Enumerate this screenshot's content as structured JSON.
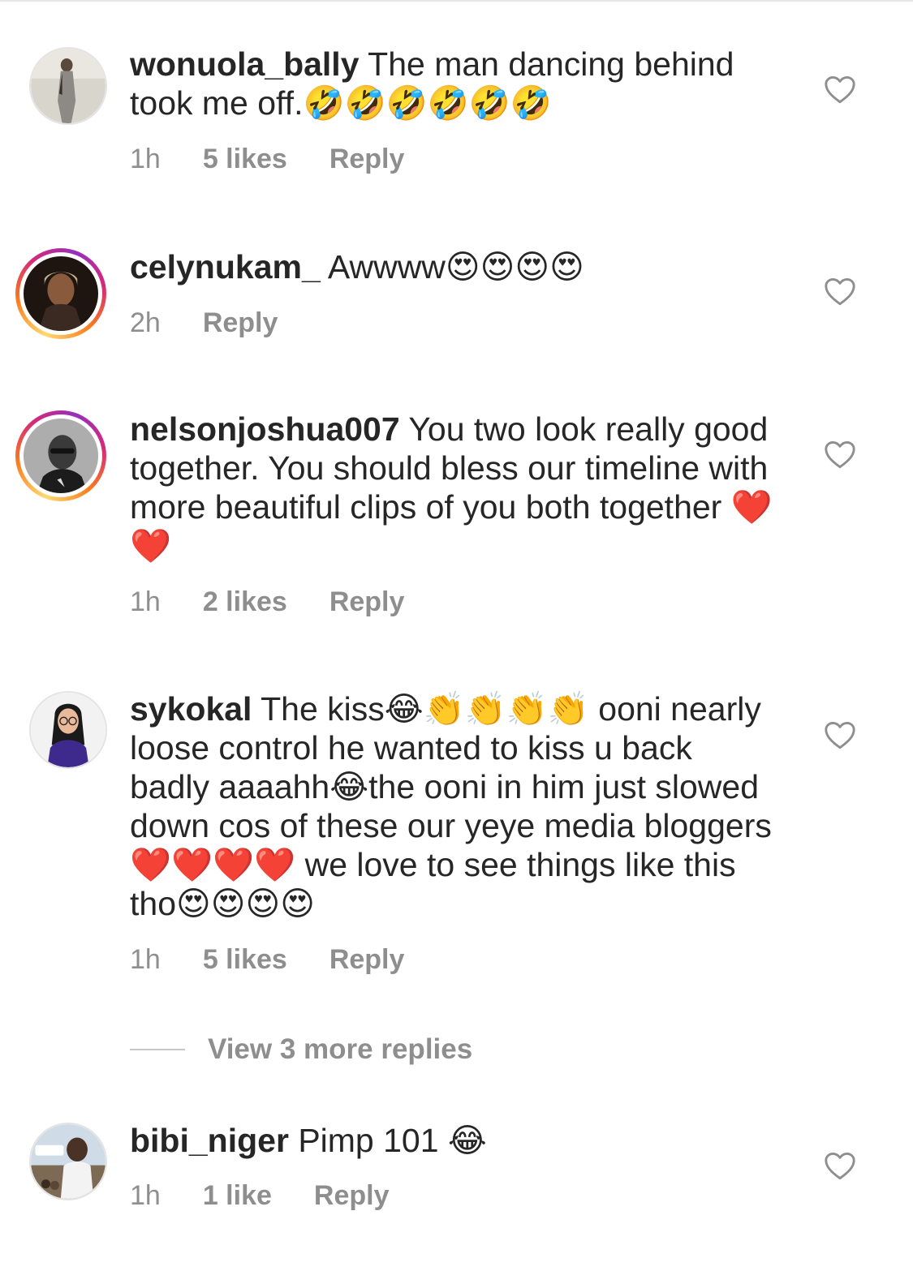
{
  "comments": [
    {
      "username": "wonuola_bally",
      "text_before": " The man dancing behind took me off.",
      "emoji": "🤣🤣🤣🤣🤣🤣",
      "time": "1h",
      "likes": "5 likes",
      "reply": "Reply",
      "avatar_ring": "none"
    },
    {
      "username": "celynukam_",
      "text_before": " Awwww",
      "emoji": "😍😍😍😍",
      "time": "2h",
      "likes": "",
      "reply": "Reply",
      "avatar_ring": "story"
    },
    {
      "username": "nelsonjoshua007",
      "text_before": " You two look really good together. You should bless our timeline with more beautiful clips of you both together ",
      "emoji": "❤️❤️",
      "time": "1h",
      "likes": "2 likes",
      "reply": "Reply",
      "avatar_ring": "story"
    },
    {
      "username": "sykokal",
      "text_1": " The kiss",
      "emoji_1": "😂👏👏👏👏",
      "text_2": " ooni nearly loose control he wanted to kiss u back badly aaaahh",
      "emoji_2": "😂",
      "text_3": "the ooni in him just slowed down cos of these our yeye media bloggers",
      "emoji_3": "❤️❤️❤️❤️",
      "text_4": " we love to see things like this tho",
      "emoji_4": "😍😍😍😍",
      "time": "1h",
      "likes": "5 likes",
      "reply": "Reply",
      "avatar_ring": "none"
    },
    {
      "username": "bibi_niger",
      "text_before": " Pimp 101 ",
      "emoji": "😂",
      "time": "1h",
      "likes": "1 like",
      "reply": "Reply",
      "avatar_ring": "none"
    }
  ],
  "view_more_replies": "View 3 more replies",
  "icons": {
    "like": "heart-outline-icon"
  },
  "colors": {
    "text": "#262626",
    "secondary": "#8e8e8e",
    "story_ring_start": "#feda75",
    "story_ring_end": "#962fbf"
  }
}
